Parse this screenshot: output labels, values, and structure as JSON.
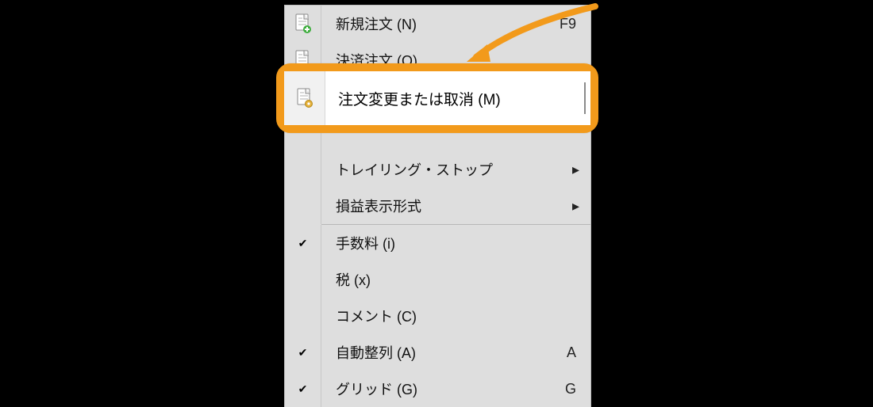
{
  "menu": {
    "items": [
      {
        "id": "new-order",
        "label": "新規注文 (N)",
        "shortcut": "F9",
        "icon": "doc-plus",
        "checked": false,
        "submenu": false
      },
      {
        "id": "close-order",
        "label": "決済注文 (O)",
        "shortcut": "",
        "icon": "doc",
        "checked": false,
        "submenu": false
      },
      {
        "id": "modify-order",
        "label": "注文変更または取消 (M)",
        "shortcut": "",
        "icon": "doc-gear",
        "checked": false,
        "submenu": false
      },
      {
        "id": "trailing-stop",
        "label": "トレイリング・ストップ",
        "shortcut": "",
        "icon": "",
        "checked": false,
        "submenu": true
      },
      {
        "id": "pnl-format",
        "label": "損益表示形式",
        "shortcut": "",
        "icon": "",
        "checked": false,
        "submenu": true
      },
      {
        "id": "fees",
        "label": "手数料 (i)",
        "shortcut": "",
        "icon": "",
        "checked": true,
        "submenu": false
      },
      {
        "id": "tax",
        "label": "税 (x)",
        "shortcut": "",
        "icon": "",
        "checked": false,
        "submenu": false
      },
      {
        "id": "comment",
        "label": "コメント (C)",
        "shortcut": "",
        "icon": "",
        "checked": false,
        "submenu": false
      },
      {
        "id": "auto-arrange",
        "label": "自動整列 (A)",
        "shortcut": "A",
        "icon": "",
        "checked": true,
        "submenu": false
      },
      {
        "id": "grid",
        "label": "グリッド (G)",
        "shortcut": "G",
        "icon": "",
        "checked": true,
        "submenu": false
      }
    ],
    "highlighted_id": "modify-order"
  }
}
